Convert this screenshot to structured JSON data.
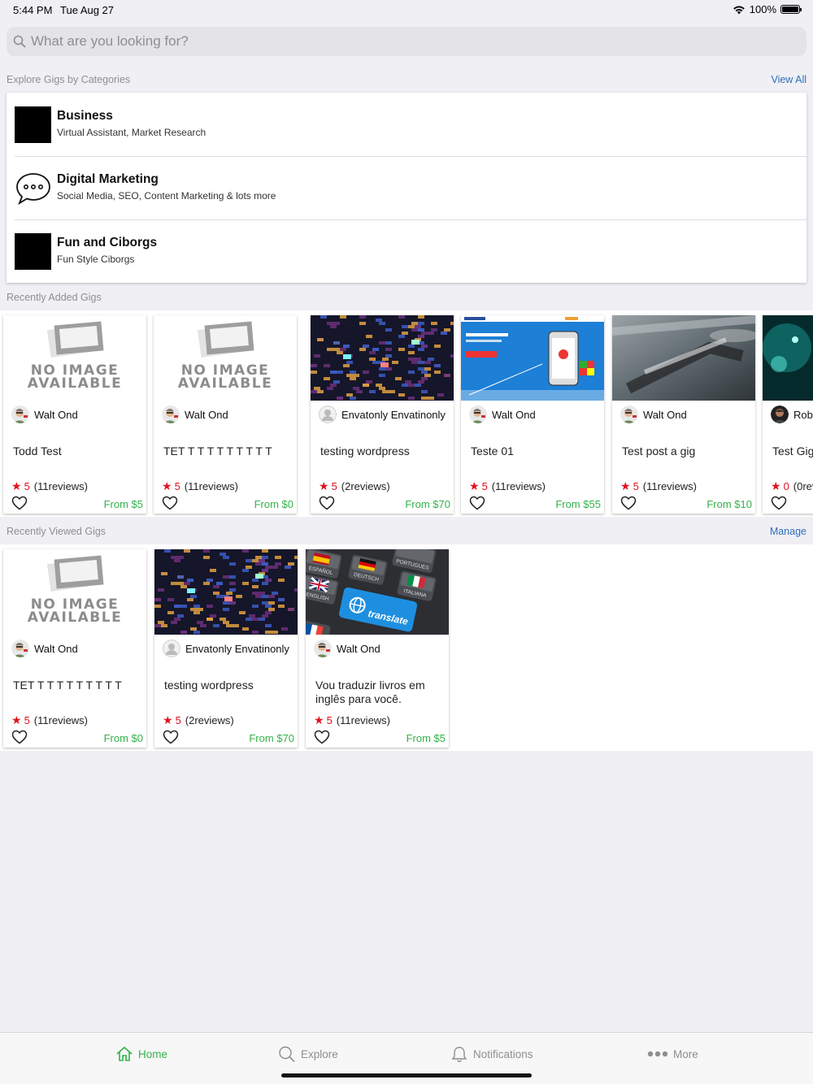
{
  "status": {
    "time": "5:44 PM",
    "date": "Tue Aug 27",
    "battery": "100%"
  },
  "search": {
    "placeholder": "What are you looking for?"
  },
  "categories_section": {
    "title": "Explore Gigs by Categories",
    "view_all": "View All",
    "items": [
      {
        "name": "Business",
        "sub": "Virtual Assistant, Market Research",
        "icon": "black-square"
      },
      {
        "name": "Digital Marketing",
        "sub": "Social Media, SEO, Content Marketing & lots more",
        "icon": "chat-bubble-icon"
      },
      {
        "name": "Fun and Ciborgs",
        "sub": "Fun Style Ciborgs",
        "icon": "black-square"
      }
    ]
  },
  "recent": {
    "title": "Recently Added Gigs",
    "gigs": [
      {
        "image": "no-image",
        "seller": "Walt Ond",
        "title": "Todd Test",
        "stars": "5",
        "reviews": "(11reviews)",
        "price": "From $5"
      },
      {
        "image": "no-image",
        "seller": "Walt Ond",
        "title": "TET T T T T T T T T T",
        "stars": "5",
        "reviews": "(11reviews)",
        "price": "From $0"
      },
      {
        "image": "circuit",
        "seller": "Envatonly Envatinonly",
        "title": "testing wordpress",
        "stars": "5",
        "reviews": "(2reviews)",
        "price": "From $70"
      },
      {
        "image": "website",
        "seller": "Walt Ond",
        "title": "Teste 01",
        "stars": "5",
        "reviews": "(11reviews)",
        "price": "From $55"
      },
      {
        "image": "blur",
        "seller": "Walt Ond",
        "title": "Test post a gig",
        "stars": "5",
        "reviews": "(11reviews)",
        "price": "From $10"
      },
      {
        "image": "teal",
        "seller": "Robin",
        "title": "Test Gig T",
        "stars": "0",
        "reviews": "(0rev",
        "price": ""
      }
    ]
  },
  "viewed": {
    "title": "Recently Viewed Gigs",
    "manage": "Manage",
    "gigs": [
      {
        "image": "no-image",
        "seller": "Walt Ond",
        "title": "TET T T T T T T T T T",
        "stars": "5",
        "reviews": "(11reviews)",
        "price": "From $0"
      },
      {
        "image": "circuit",
        "seller": "Envatonly Envatinonly",
        "title": "testing wordpress",
        "stars": "5",
        "reviews": "(2reviews)",
        "price": "From $70"
      },
      {
        "image": "translate",
        "seller": "Walt Ond",
        "title": "Vou traduzir livros em inglês para você.",
        "stars": "5",
        "reviews": "(11reviews)",
        "price": "From $5"
      }
    ]
  },
  "no_image_text": {
    "line1": "NO IMAGE",
    "line2": "AVAILABLE"
  },
  "translate_image": {
    "keys": [
      "ESPAÑOL",
      "DEUTSCH",
      "PORTUGUES",
      "ITALIANA",
      "ENGLISH",
      "translate"
    ]
  },
  "tabs": [
    {
      "label": "Home",
      "icon": "home-icon",
      "active": true
    },
    {
      "label": "Explore",
      "icon": "search-icon",
      "active": false
    },
    {
      "label": "Notifications",
      "icon": "bell-icon",
      "active": false
    },
    {
      "label": "More",
      "icon": "more-dots-icon",
      "active": false
    }
  ],
  "colors": {
    "accent": "#33b24a",
    "link": "#2f6fb5",
    "star": "#e3101e",
    "background": "#efeff4"
  }
}
